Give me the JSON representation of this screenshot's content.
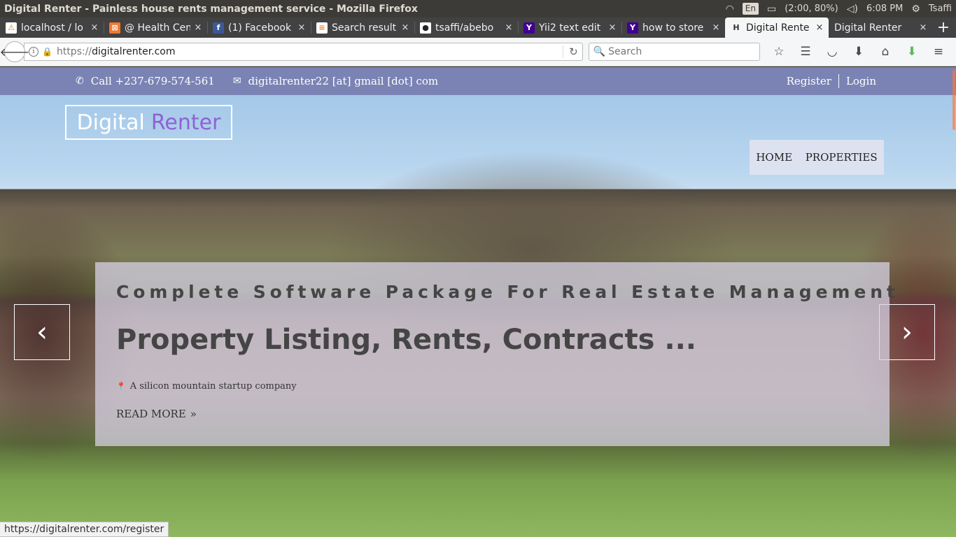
{
  "os": {
    "window_title": "Digital Renter - Painless house rents management service - Mozilla Firefox",
    "lang": "En",
    "battery": "(2:00, 80%)",
    "time": "6:08 PM",
    "user": "Tsaffi"
  },
  "tabs": [
    {
      "label": "localhost / lo",
      "favicon": "⚠",
      "favicon_bg": "#ffffff",
      "favicon_color": "#e67e22",
      "close": "×"
    },
    {
      "label": "@ Health Cen",
      "favicon": "⊠",
      "favicon_bg": "#f07830",
      "favicon_color": "#ffffff",
      "close": "×"
    },
    {
      "label": "(1) Facebook",
      "favicon": "f",
      "favicon_bg": "#3b5998",
      "favicon_color": "#ffffff",
      "close": "×"
    },
    {
      "label": "Search result",
      "favicon": "≡",
      "favicon_bg": "#ffffff",
      "favicon_color": "#f48024",
      "close": "×"
    },
    {
      "label": "tsaffi/abebo",
      "favicon": "●",
      "favicon_bg": "#ffffff",
      "favicon_color": "#222222",
      "close": "×"
    },
    {
      "label": "Yii2 text edit",
      "favicon": "Y",
      "favicon_bg": "#410093",
      "favicon_color": "#ffffff",
      "close": "×"
    },
    {
      "label": "how to store",
      "favicon": "Y",
      "favicon_bg": "#410093",
      "favicon_color": "#ffffff",
      "close": "×"
    },
    {
      "label": "Digital Rente",
      "favicon": "H",
      "favicon_bg": "transparent",
      "favicon_color": "#333333",
      "close": "×"
    },
    {
      "label": "Digital Renter",
      "favicon": "",
      "favicon_bg": "transparent",
      "favicon_color": "#ffffff",
      "close": "×"
    }
  ],
  "new_tab": "+",
  "nav": {
    "url_proto": "https://",
    "url_host": "digitalrenter.com",
    "search_placeholder": "Search"
  },
  "site": {
    "phone": "Call +237-679-574-561",
    "email": "digitalrenter22 [at] gmail [dot] com",
    "register": "Register",
    "login": "Login",
    "logo_part1": "Digital",
    "logo_part2": "Renter",
    "menu_home": "HOME",
    "menu_properties": "PROPERTIES",
    "slide_subtitle": "Complete Software Package For Real Estate Management",
    "slide_title": "Property Listing, Rents, Contracts ...",
    "slide_location": "A silicon mountain startup company",
    "read_more": "READ MORE",
    "accent_color": "#8e62d6",
    "topbar_color": "#787fb0"
  },
  "status_url": "https://digitalrenter.com/register"
}
